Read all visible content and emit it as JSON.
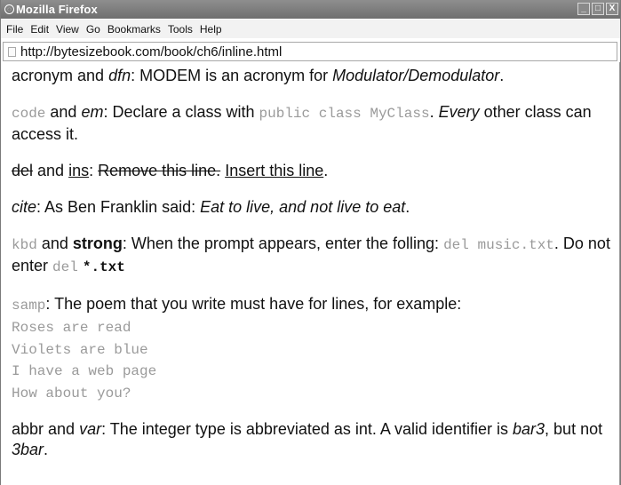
{
  "window": {
    "title": "Mozilla Firefox",
    "buttons": [
      "_",
      "□",
      "X"
    ]
  },
  "menu": [
    "File",
    "Edit",
    "View",
    "Go",
    "Bookmarks",
    "Tools",
    "Help"
  ],
  "url": "http://bytesizebook.com/book/ch6/inline.html",
  "content": {
    "p1": {
      "a": "acronym and ",
      "b": "dfn",
      "c": ": MODEM is an acronym for ",
      "d": "Modulator/Demodulator",
      "e": "."
    },
    "p2": {
      "a": "code",
      "b": " and ",
      "c": "em",
      "d": ": Declare a class with ",
      "e": "public class MyClass",
      "f": ". ",
      "g": "Every",
      "h": " other class can access it."
    },
    "p3": {
      "a": "del",
      "b": " and ",
      "c": "ins",
      "d": ": ",
      "e": "Remove this line.",
      "f": " ",
      "g": "Insert this line",
      "h": "."
    },
    "p4": {
      "a": "cite",
      "b": ": As Ben Franklin said: ",
      "c": "Eat to live, and not live to eat",
      "d": "."
    },
    "p5": {
      "a": "kbd",
      "b": " and ",
      "c": "strong",
      "d": ": When the prompt appears, enter the folling: ",
      "e": "del music.txt",
      "f": ". Do not enter ",
      "g": "del",
      "h": " ",
      "i": "*.txt"
    },
    "p6": {
      "a": "samp",
      "b": ": The poem that you write must have for lines, for example:",
      "lines": [
        "Roses are read",
        "Violets are blue",
        "I have a web page",
        "How about you?"
      ]
    },
    "p7": {
      "a": "abbr and ",
      "b": "var",
      "c": ": The integer type is abbreviated as int. A valid identifier is ",
      "d": "bar3",
      "e": ", but not ",
      "f": "3bar",
      "g": "."
    }
  }
}
